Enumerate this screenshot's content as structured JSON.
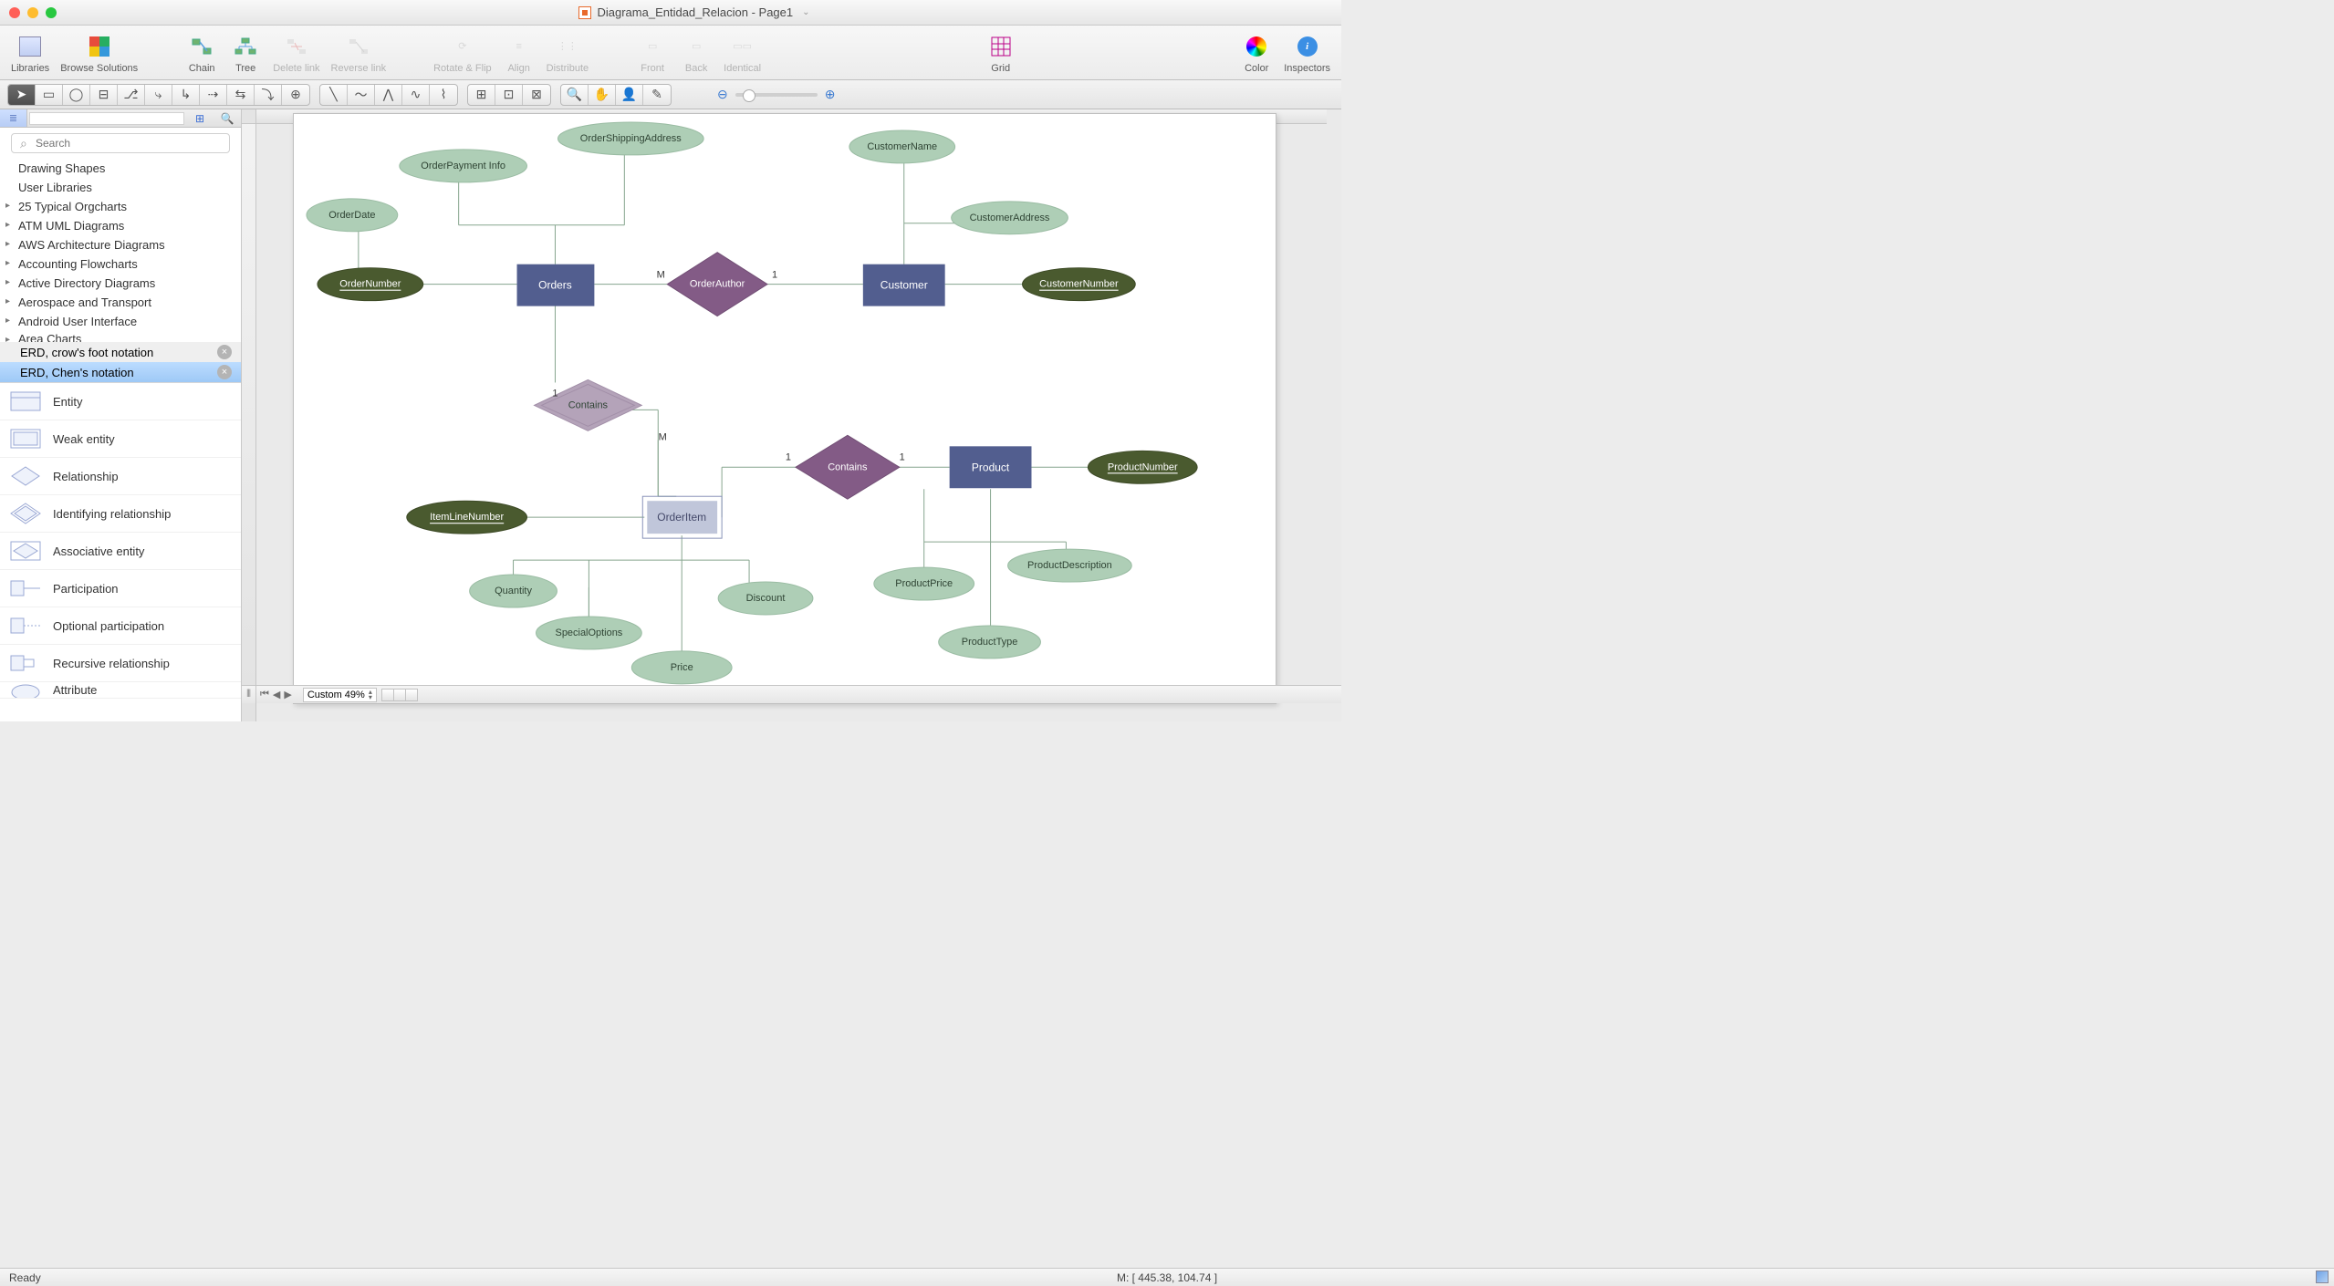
{
  "window": {
    "title": "Diagrama_Entidad_Relacion - Page1"
  },
  "toolbar": {
    "libraries": "Libraries",
    "browse": "Browse Solutions",
    "chain": "Chain",
    "tree": "Tree",
    "delete_link": "Delete link",
    "reverse_link": "Reverse link",
    "rotate_flip": "Rotate & Flip",
    "align": "Align",
    "distribute": "Distribute",
    "front": "Front",
    "back": "Back",
    "identical": "Identical",
    "grid": "Grid",
    "color": "Color",
    "inspectors": "Inspectors"
  },
  "sidebar": {
    "search_placeholder": "Search",
    "libraries": [
      {
        "label": "Drawing Shapes",
        "arrow": false
      },
      {
        "label": "User Libraries",
        "arrow": false
      },
      {
        "label": "25 Typical Orgcharts",
        "arrow": true
      },
      {
        "label": "ATM UML Diagrams",
        "arrow": true
      },
      {
        "label": "AWS Architecture Diagrams",
        "arrow": true
      },
      {
        "label": "Accounting Flowcharts",
        "arrow": true
      },
      {
        "label": "Active Directory Diagrams",
        "arrow": true
      },
      {
        "label": "Aerospace and Transport",
        "arrow": true
      },
      {
        "label": "Android User Interface",
        "arrow": true
      },
      {
        "label": "Area Charts",
        "arrow": true
      }
    ],
    "sections": {
      "crows": "ERD, crow's foot notation",
      "chen": "ERD, Chen's notation"
    },
    "shapes": [
      "Entity",
      "Weak entity",
      "Relationship",
      "Identifying relationship",
      "Associative entity",
      "Participation",
      "Optional participation",
      "Recursive relationship",
      "Attribute"
    ]
  },
  "diagram": {
    "entities": {
      "orders": "Orders",
      "customer": "Customer",
      "product": "Product",
      "order_item": "OrderItem"
    },
    "relationships": {
      "order_author": "OrderAuthor",
      "contains_top": "Contains",
      "contains_right": "Contains"
    },
    "attributes": {
      "order_date": "OrderDate",
      "order_payment": "OrderPayment Info",
      "order_shipping": "OrderShippingAddress",
      "customer_name": "CustomerName",
      "customer_address": "CustomerAddress",
      "quantity": "Quantity",
      "special_options": "SpecialOptions",
      "price": "Price",
      "discount": "Discount",
      "product_price": "ProductPrice",
      "product_description": "ProductDescription",
      "product_type": "ProductType"
    },
    "keys": {
      "order_number": "OrderNumber",
      "customer_number": "CustomerNumber",
      "item_line_number": "ItemLineNumber",
      "product_number": "ProductNumber"
    },
    "cardinalities": {
      "one": "1",
      "many": "M"
    }
  },
  "status": {
    "zoom_label": "Custom 49%",
    "ready": "Ready",
    "mouse": "M: [ 445.38, 104.74 ]"
  }
}
